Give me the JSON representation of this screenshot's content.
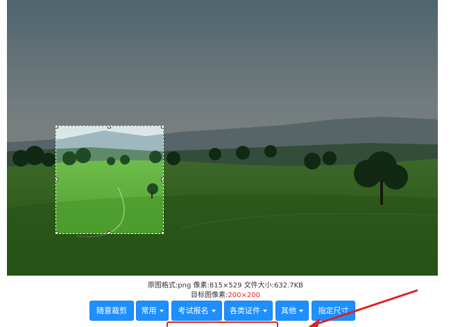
{
  "image_info": {
    "original_label": "原图格式:png  像素:815×529  文件大小:632.7KB",
    "target_prefix": "目标图像素:",
    "target_value": "200×200"
  },
  "toolbar": {
    "buttons": [
      {
        "label": "随意裁剪",
        "dropdown": false
      },
      {
        "label": "常用",
        "dropdown": true
      },
      {
        "label": "考试报名",
        "dropdown": true
      },
      {
        "label": "各类证件",
        "dropdown": true
      },
      {
        "label": "其他",
        "dropdown": true
      },
      {
        "label": "指定尺寸",
        "dropdown": false
      }
    ]
  },
  "colors": {
    "button_bg": "#1e8fff",
    "annotation_red": "#e02222",
    "target_text": "#e0281f"
  },
  "icons": [
    "chevron-down-icon",
    "arrow-annotation-icon"
  ]
}
